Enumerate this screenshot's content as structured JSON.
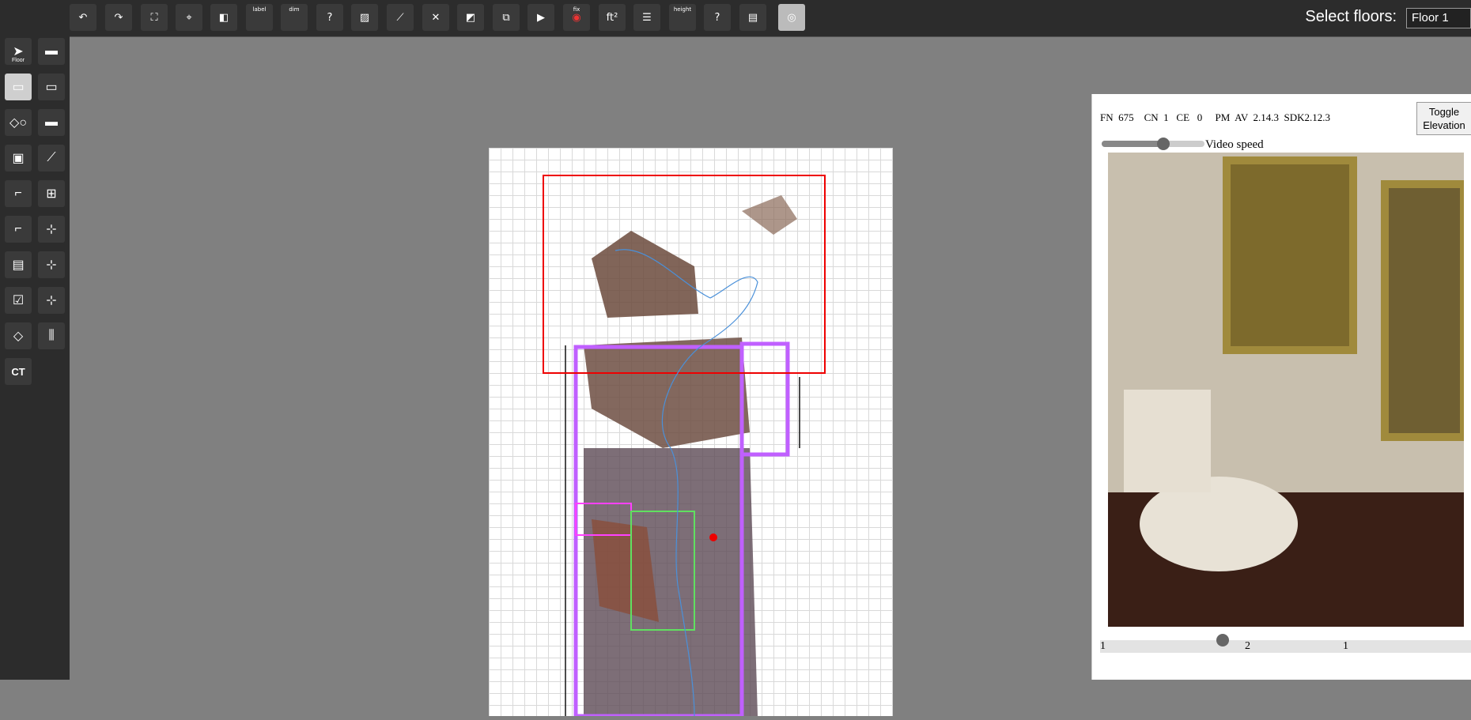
{
  "toolbar": {
    "items": [
      {
        "name": "undo-icon",
        "glyph": "↶"
      },
      {
        "name": "redo-icon",
        "glyph": "↷"
      },
      {
        "name": "fit-view-icon",
        "glyph": "⛶"
      },
      {
        "name": "crosshair-icon",
        "glyph": "⌖"
      },
      {
        "name": "split-view-icon",
        "glyph": "◧"
      },
      {
        "name": "label-tool-icon",
        "glyph": "",
        "text": "label"
      },
      {
        "name": "dim-tool-icon",
        "glyph": "",
        "text": "dim"
      },
      {
        "name": "question-tool-icon",
        "glyph": "?"
      },
      {
        "name": "hatch-tool-icon",
        "glyph": "▨"
      },
      {
        "name": "measure-angle-icon",
        "glyph": "⟋"
      },
      {
        "name": "intersect-icon",
        "glyph": "✕"
      },
      {
        "name": "fill-tool-icon",
        "glyph": "◩"
      },
      {
        "name": "layout-icon",
        "glyph": "⧉"
      },
      {
        "name": "play-step-icon",
        "glyph": "▶"
      },
      {
        "name": "view-fix-icon",
        "glyph": "◉",
        "text": "fix"
      },
      {
        "name": "area-unit-icon",
        "glyph": "ft²"
      },
      {
        "name": "list-icon",
        "glyph": "☰"
      },
      {
        "name": "height-tool-icon",
        "glyph": "",
        "text": "height"
      },
      {
        "name": "help-line-icon",
        "glyph": "?"
      },
      {
        "name": "document-icon",
        "glyph": "▤"
      },
      {
        "name": "eye-toggle-icon",
        "glyph": "◎"
      }
    ]
  },
  "floors": {
    "label": "Select floors:",
    "selected": "Floor 1"
  },
  "sidebar": {
    "items": [
      {
        "name": "select-floor-tool",
        "glyph": "➤",
        "text": "Floor"
      },
      {
        "name": "wall-tool",
        "glyph": "▬"
      },
      {
        "name": "room-tool",
        "glyph": "▭"
      },
      {
        "name": "opening-tool",
        "glyph": "▭"
      },
      {
        "name": "door-window-tool",
        "glyph": "◇○"
      },
      {
        "name": "thick-wall-tool",
        "glyph": "▬"
      },
      {
        "name": "cabinet-tool",
        "glyph": "▣"
      },
      {
        "name": "diagonal-tool",
        "glyph": "⟋"
      },
      {
        "name": "stairs-tool",
        "glyph": "⌐"
      },
      {
        "name": "connect-tool",
        "glyph": "⊞"
      },
      {
        "name": "corner-tool",
        "glyph": "⌐"
      },
      {
        "name": "node-move-tool",
        "glyph": "⊹"
      },
      {
        "name": "appliance-tool",
        "glyph": "▤"
      },
      {
        "name": "split-tool",
        "glyph": "⊹"
      },
      {
        "name": "checklist-tool",
        "glyph": "☑"
      },
      {
        "name": "node-select-tool",
        "glyph": "⊹"
      },
      {
        "name": "diamond-tool",
        "glyph": "◇"
      },
      {
        "name": "column-tool",
        "glyph": "⫼"
      },
      {
        "name": "ct-tool",
        "glyph": "",
        "text": "CT"
      }
    ]
  },
  "stats": {
    "text": "FN  675    CN  1   CE   0     PM  AV  2.14.3  SDK2.12.3"
  },
  "toggle_elevation": "Toggle Elevation",
  "video": {
    "speed_label": "Video speed",
    "speed_value": 0.6,
    "timeline_labels": [
      "1",
      "2",
      "1"
    ],
    "timeline_position": 0.33
  }
}
